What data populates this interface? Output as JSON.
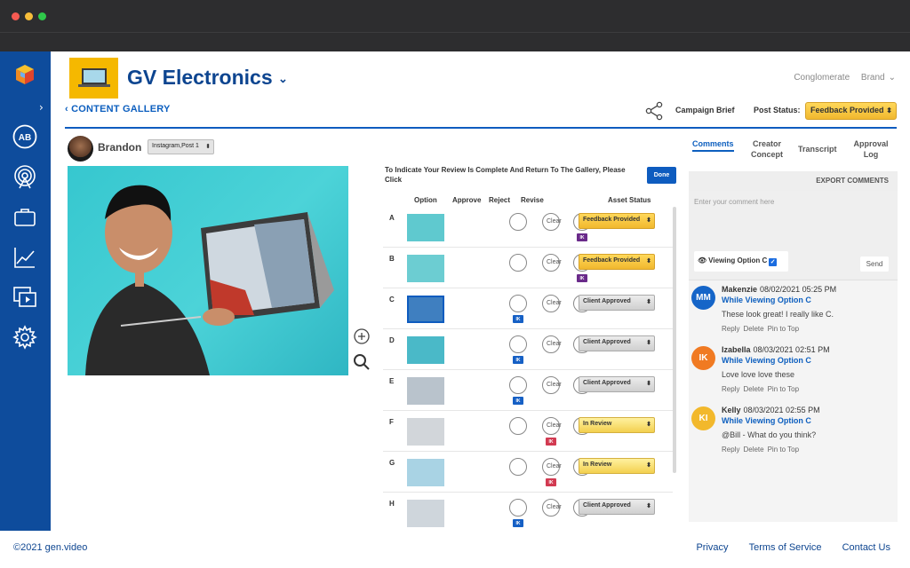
{
  "window": {
    "controls": [
      "close",
      "minimize",
      "maximize"
    ]
  },
  "sidebar": {
    "items": [
      {
        "icon": "logo-cubes-icon"
      },
      {
        "icon": "expand-chevron-icon"
      },
      {
        "label": "AB",
        "icon": "account-avatar"
      },
      {
        "icon": "broadcast-icon"
      },
      {
        "icon": "briefcase-icon"
      },
      {
        "icon": "analytics-icon"
      },
      {
        "icon": "media-library-icon"
      },
      {
        "icon": "gear-icon"
      }
    ]
  },
  "header": {
    "brand": "GV Electronics",
    "links": [
      "Conglomerate",
      "Brand"
    ],
    "back_label": "CONTENT GALLERY",
    "campaign_brief": "Campaign Brief",
    "post_status_label": "Post Status:",
    "post_status_value": "Feedback Provided"
  },
  "post": {
    "user_name": "Brandon",
    "selected_post": "Instagram,Post 1"
  },
  "review": {
    "instruction": "To Indicate Your Review Is Complete And Return To The Gallery, Please Click",
    "done_label": "Done",
    "columns": [
      "Option",
      "Approve",
      "Reject",
      "Revise",
      "Asset Status"
    ],
    "clear_label": "Clear",
    "rows": [
      {
        "letter": "A",
        "badge": "IK",
        "badge_col": "revise",
        "status": "Feedback Provided",
        "style": "fb"
      },
      {
        "letter": "B",
        "badge": "IK",
        "badge_col": "revise",
        "status": "Feedback Provided",
        "style": "fb"
      },
      {
        "letter": "C",
        "badge": "IK",
        "badge_col": "approve",
        "status": "Client Approved",
        "style": "ca",
        "selected": true
      },
      {
        "letter": "D",
        "badge": "IK",
        "badge_col": "approve",
        "status": "Client Approved",
        "style": "ca"
      },
      {
        "letter": "E",
        "badge": "IK",
        "badge_col": "approve",
        "status": "Client Approved",
        "style": "ca"
      },
      {
        "letter": "F",
        "badge": "IK",
        "badge_col": "reject",
        "status": "In Review",
        "style": "ir"
      },
      {
        "letter": "G",
        "badge": "IK",
        "badge_col": "reject",
        "status": "In Review",
        "style": "ir"
      },
      {
        "letter": "H",
        "badge": "IK",
        "badge_col": "approve",
        "status": "Client Approved",
        "style": "ca"
      }
    ]
  },
  "tabs": [
    {
      "label": "Comments",
      "active": true
    },
    {
      "label": "Creator Concept"
    },
    {
      "label": "Transcript"
    },
    {
      "label": "Approval Log"
    }
  ],
  "comments": {
    "export_label": "EXPORT COMMENTS",
    "placeholder": "Enter your comment here",
    "viewing_option_label": "Viewing Option C",
    "send_label": "Send",
    "items": [
      {
        "initials": "MM",
        "color": "#1565c8",
        "name": "Makenzie",
        "time": "08/02/2021 05:25 PM",
        "context": "While Viewing Option C",
        "body": "These look great! I really like C.",
        "actions": [
          "Reply",
          "Delete",
          "Pin to Top"
        ]
      },
      {
        "initials": "IK",
        "color": "#f07a22",
        "name": "Izabella",
        "time": "08/03/2021 02:51 PM",
        "context": "While Viewing Option C",
        "body": "Love love love these",
        "actions": [
          "Reply",
          "Delete",
          "Pin to Top"
        ]
      },
      {
        "initials": "KI",
        "color": "#f2b82c",
        "name": "Kelly",
        "time": "08/03/2021 02:55 PM",
        "context": "While Viewing Option C",
        "body": "@Bill - What do you think?",
        "actions": [
          "Reply",
          "Delete",
          "Pin to Top"
        ]
      }
    ]
  },
  "footer": {
    "copyright": "©2021 gen.video",
    "links": [
      "Privacy",
      "Terms of Service",
      "Contact Us"
    ]
  }
}
